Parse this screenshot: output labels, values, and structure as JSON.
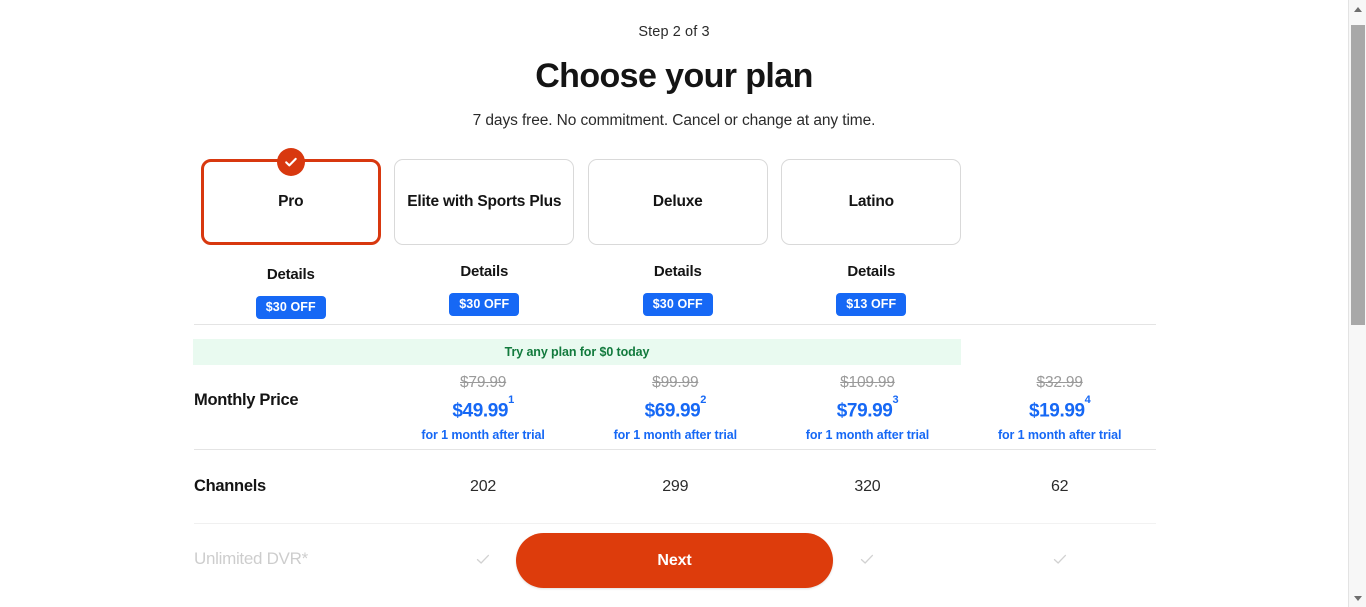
{
  "header": {
    "step_label": "Step 2 of 3",
    "title": "Choose your plan",
    "subtitle": "7 days free. No commitment. Cancel or change at any time."
  },
  "colors": {
    "selected_border": "#d8380f",
    "badge_blue": "#1668f5",
    "promo_green_bg": "#e9faf0",
    "promo_green_text": "#127a3d",
    "cta_orange": "#dd3c0c"
  },
  "plans": [
    {
      "name": "Pro",
      "selected": true,
      "selected_icon": "check-circle-icon",
      "details_label": "Details",
      "discount_badge": "$30 OFF"
    },
    {
      "name": "Elite with Sports Plus",
      "selected": false,
      "details_label": "Details",
      "discount_badge": "$30 OFF"
    },
    {
      "name": "Deluxe",
      "selected": false,
      "details_label": "Details",
      "discount_badge": "$30 OFF"
    },
    {
      "name": "Latino",
      "selected": false,
      "details_label": "Details",
      "discount_badge": "$13 OFF"
    }
  ],
  "promo_banner": {
    "text": "Try any plan for $0 today"
  },
  "comparison": {
    "rows": [
      {
        "label": "Monthly Price",
        "type": "price",
        "cells": [
          {
            "old_price": "$79.99",
            "new_price": "$49.99",
            "footnote": "1",
            "note": "for 1 month after trial"
          },
          {
            "old_price": "$99.99",
            "new_price": "$69.99",
            "footnote": "2",
            "note": "for 1 month after trial"
          },
          {
            "old_price": "$109.99",
            "new_price": "$79.99",
            "footnote": "3",
            "note": "for 1 month after trial"
          },
          {
            "old_price": "$32.99",
            "new_price": "$19.99",
            "footnote": "4",
            "note": "for 1 month after trial"
          }
        ]
      },
      {
        "label": "Channels",
        "type": "number",
        "cells": [
          {
            "value": "202"
          },
          {
            "value": "299"
          },
          {
            "value": "320"
          },
          {
            "value": "62"
          }
        ]
      },
      {
        "label": "Unlimited DVR*",
        "type": "check",
        "cells": [
          {
            "icon": "check-icon",
            "included": true
          },
          {
            "icon": "check-icon",
            "included": true
          },
          {
            "icon": "check-icon",
            "included": true
          },
          {
            "icon": "check-icon",
            "included": true
          }
        ]
      }
    ]
  },
  "cta": {
    "next_label": "Next"
  },
  "scrollbar": {
    "up_icon": "triangle-up-icon",
    "down_icon": "triangle-down-icon"
  }
}
